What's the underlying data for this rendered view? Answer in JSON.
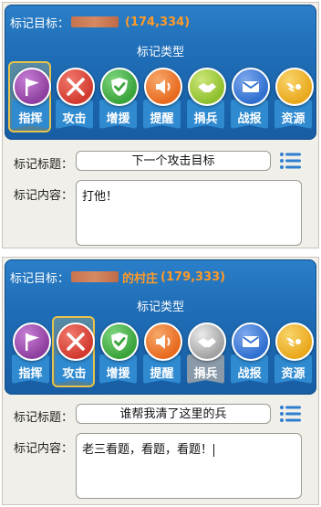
{
  "colors": {
    "banner": "#1f6eb7",
    "coords": "#ff9a28",
    "panel": "#f0efe9"
  },
  "panels": [
    {
      "target_label": "标记目标：",
      "village_suffix": "",
      "coords": "(174,334)",
      "type_title": "标记类型",
      "selected_type": "指挥",
      "title_label": "标记标题：",
      "title_value": "下一个攻击目标",
      "content_label": "标记内容：",
      "content_value": "打他！"
    },
    {
      "target_label": "标记目标：",
      "village_suffix": "的村庄",
      "coords": "(179,333)",
      "type_title": "标记类型",
      "selected_type": "攻击",
      "title_label": "标记标题：",
      "title_value": "谁帮我清了这里的兵",
      "content_label": "标记内容：",
      "content_value": "老三看题，看题，看题！"
    }
  ],
  "mark_types": [
    {
      "label": "指挥",
      "icon": "flag-icon",
      "color": "#8e3f9e"
    },
    {
      "label": "攻击",
      "icon": "crossed-swords-icon",
      "color": "#d23a2f"
    },
    {
      "label": "增援",
      "icon": "shield-check-icon",
      "color": "#3aa33a"
    },
    {
      "label": "提醒",
      "icon": "speaker-icon",
      "color": "#e86a1e"
    },
    {
      "label": "捐兵",
      "icon": "handshake-icon",
      "color": "#8fbf2c"
    },
    {
      "label": "战报",
      "icon": "envelope-icon",
      "color": "#2f6fd0"
    },
    {
      "label": "资源",
      "icon": "wings-icon",
      "color": "#e9a81c"
    }
  ]
}
